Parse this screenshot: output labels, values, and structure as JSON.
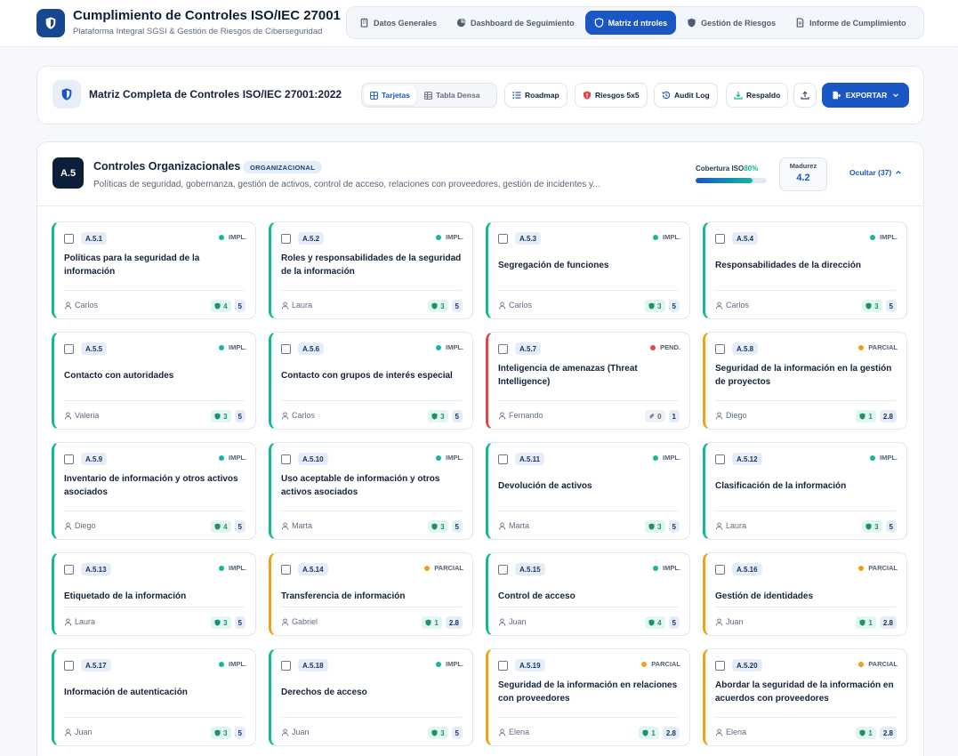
{
  "app": {
    "title": "Cumplimiento de Controles ISO/IEC 27001",
    "subtitle": "Plataforma Integral SGSI & Gestión de Riesgos de Ciberseguridad"
  },
  "nav": {
    "tabs": [
      {
        "label": "Datos Generales",
        "icon": "building-icon"
      },
      {
        "label": "Dashboard de Seguimiento",
        "icon": "pie-chart-icon"
      },
      {
        "label": "Matriz d   ntroles",
        "icon": "shield-icon"
      },
      {
        "label": "Gestión de Riesgos",
        "icon": "shield-icon"
      },
      {
        "label": "Informe de Cumplimiento",
        "icon": "document-icon"
      }
    ],
    "active_index": 2
  },
  "toolbar": {
    "title": "Matriz Completa de Controles ISO/IEC 27001:2022",
    "view_cards": "Tarjetas",
    "view_table": "Tabla Densa",
    "roadmap": "Roadmap",
    "risks": "Riesgos 5x5",
    "audit": "Audit Log",
    "backup": "Respaldo",
    "export": "EXPORTAR"
  },
  "section": {
    "code": "A.5",
    "title": "Controles Organizacionales",
    "tag": "ORGANIZACIONAL",
    "description": "Políticas de seguridad, gobernanza, gestión de activos, control de acceso, relaciones con proveedores, gestión de incidentes y...",
    "coverage_label": "Cobertura ISO",
    "coverage_value": "80%",
    "coverage_fraction": 0.8,
    "maturity_label": "Madurez",
    "maturity_value": "4.2",
    "hide_label": "Ocultar (37)"
  },
  "colors": {
    "primary": "#1a56c4",
    "implemented": "#15b79a",
    "partial": "#f0a21a",
    "pending": "#e04848",
    "dark": "#0d1e3a"
  },
  "controls": [
    {
      "code": "A.5.1",
      "status": "IMPL.",
      "state": "impl",
      "title": "Políticas para la seguridad de la información",
      "owner": "Carlos",
      "risks": "4",
      "maturity": "5"
    },
    {
      "code": "A.5.2",
      "status": "IMPL.",
      "state": "impl",
      "title": "Roles y responsabilidades de la seguridad de la información",
      "owner": "Laura",
      "risks": "3",
      "maturity": "5"
    },
    {
      "code": "A.5.3",
      "status": "IMPL.",
      "state": "impl",
      "title": "Segregación de funciones",
      "owner": "Carlos",
      "risks": "3",
      "maturity": "5"
    },
    {
      "code": "A.5.4",
      "status": "IMPL.",
      "state": "impl",
      "title": "Responsabilidades de la dirección",
      "owner": "Carlos",
      "risks": "3",
      "maturity": "5"
    },
    {
      "code": "A.5.5",
      "status": "IMPL.",
      "state": "impl",
      "title": "Contacto con autoridades",
      "owner": "Valeria",
      "risks": "3",
      "maturity": "5"
    },
    {
      "code": "A.5.6",
      "status": "IMPL.",
      "state": "impl",
      "title": "Contacto con grupos de interés especial",
      "owner": "Carlos",
      "risks": "3",
      "maturity": "5"
    },
    {
      "code": "A.5.7",
      "status": "PEND.",
      "state": "pend",
      "title": "Inteligencia de amenazas (Threat Intelligence)",
      "owner": "Fernando",
      "risks": "0",
      "maturity": "1"
    },
    {
      "code": "A.5.8",
      "status": "PARCIAL",
      "state": "parcial",
      "title": "Seguridad de la información en la gestión de proyectos",
      "owner": "Diego",
      "risks": "1",
      "maturity": "2.8"
    },
    {
      "code": "A.5.9",
      "status": "IMPL.",
      "state": "impl",
      "title": "Inventario de información y otros activos asociados",
      "owner": "Diego",
      "risks": "4",
      "maturity": "5"
    },
    {
      "code": "A.5.10",
      "status": "IMPL.",
      "state": "impl",
      "title": "Uso aceptable de información y otros activos asociados",
      "owner": "Marta",
      "risks": "3",
      "maturity": "5"
    },
    {
      "code": "A.5.11",
      "status": "IMPL.",
      "state": "impl",
      "title": "Devolución de activos",
      "owner": "Marta",
      "risks": "3",
      "maturity": "5"
    },
    {
      "code": "A.5.12",
      "status": "IMPL.",
      "state": "impl",
      "title": "Clasificación de la información",
      "owner": "Laura",
      "risks": "3",
      "maturity": "5"
    },
    {
      "code": "A.5.13",
      "status": "IMPL.",
      "state": "impl",
      "title": "Etiquetado de la información",
      "owner": "Laura",
      "risks": "3",
      "maturity": "5"
    },
    {
      "code": "A.5.14",
      "status": "PARCIAL",
      "state": "parcial",
      "title": "Transferencia de información",
      "owner": "Gabriel",
      "risks": "1",
      "maturity": "2.8"
    },
    {
      "code": "A.5.15",
      "status": "IMPL.",
      "state": "impl",
      "title": "Control de acceso",
      "owner": "Juan",
      "risks": "4",
      "maturity": "5"
    },
    {
      "code": "A.5.16",
      "status": "PARCIAL",
      "state": "parcial",
      "title": "Gestión de identidades",
      "owner": "Juan",
      "risks": "1",
      "maturity": "2.8"
    },
    {
      "code": "A.5.17",
      "status": "IMPL.",
      "state": "impl",
      "title": "Información de autenticación",
      "owner": "Juan",
      "risks": "3",
      "maturity": "5"
    },
    {
      "code": "A.5.18",
      "status": "IMPL.",
      "state": "impl",
      "title": "Derechos de acceso",
      "owner": "Juan",
      "risks": "3",
      "maturity": "5"
    },
    {
      "code": "A.5.19",
      "status": "PARCIAL",
      "state": "parcial",
      "title": "Seguridad de la información en relaciones con proveedores",
      "owner": "Elena",
      "risks": "1",
      "maturity": "2.8"
    },
    {
      "code": "A.5.20",
      "status": "PARCIAL",
      "state": "parcial",
      "title": "Abordar la seguridad de la información en acuerdos con proveedores",
      "owner": "Elena",
      "risks": "1",
      "maturity": "2.8"
    }
  ]
}
